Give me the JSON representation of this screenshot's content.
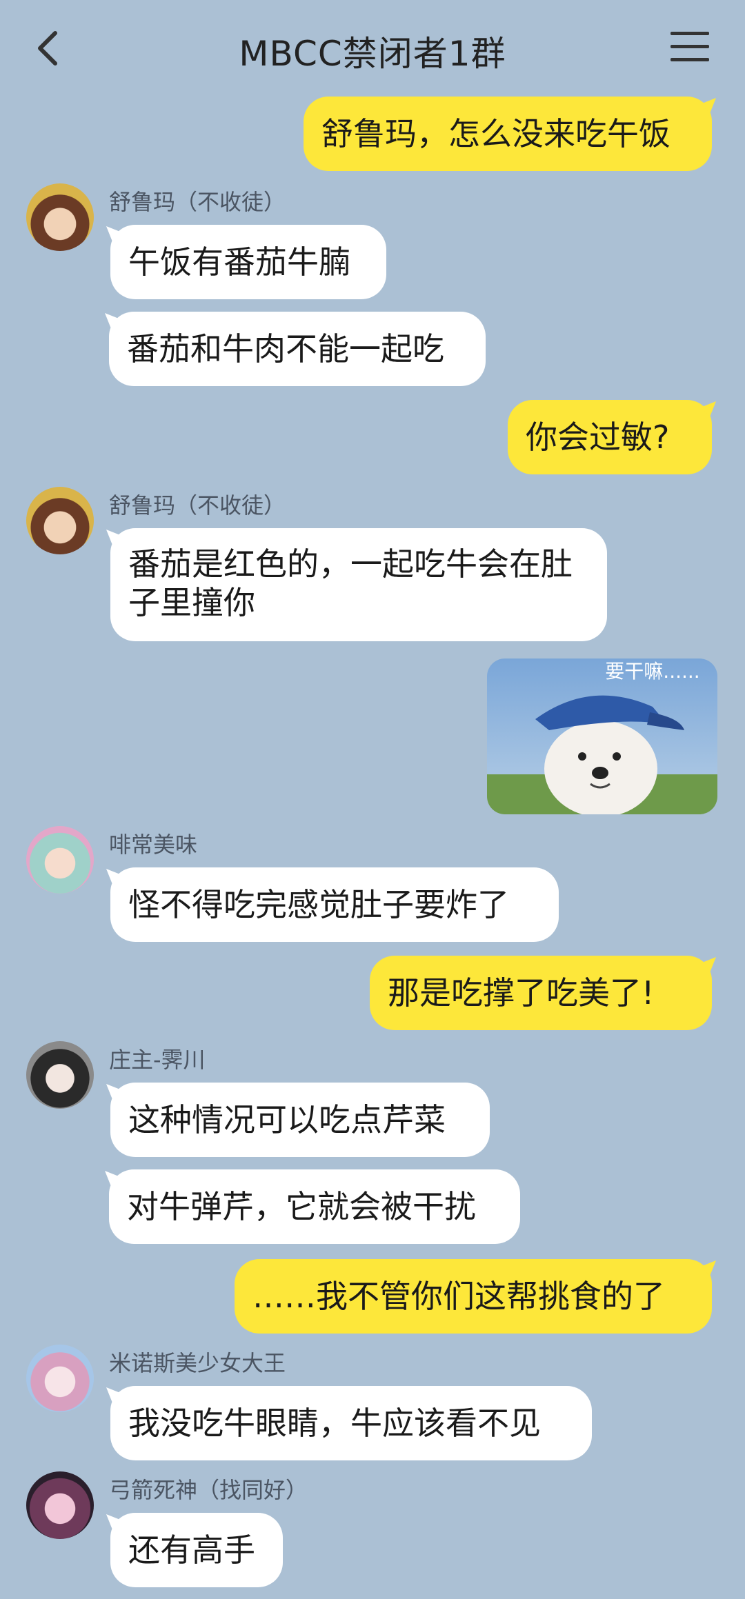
{
  "header": {
    "title": "MBCC禁闭者1群"
  },
  "colors": {
    "background": "#abc0d4",
    "outgoing_bubble": "#fde73a",
    "incoming_bubble": "#ffffff"
  },
  "messages": [
    {
      "text": "舒鲁玛，怎么没来吃午饭"
    },
    {
      "sender": "舒鲁玛（不收徒）",
      "text": "午饭有番茄牛腩"
    },
    {
      "text": "番茄和牛肉不能一起吃"
    },
    {
      "text": "你会过敏?"
    },
    {
      "sender": "舒鲁玛（不收徒）",
      "text": "番茄是红色的，一起吃牛会在肚子里撞你"
    },
    {
      "sticker_caption": "要干嘛......"
    },
    {
      "sender": "啡常美味",
      "text": "怪不得吃完感觉肚子要炸了"
    },
    {
      "text": "那是吃撑了吃美了!"
    },
    {
      "sender": "庄主-霁川",
      "text": "这种情况可以吃点芹菜"
    },
    {
      "text": "对牛弹芹，它就会被干扰"
    },
    {
      "text": "……我不管你们这帮挑食的了"
    },
    {
      "sender": "米诺斯美少女大王",
      "text": "我没吃牛眼睛，牛应该看不见"
    },
    {
      "sender": "弓箭死神（找同好）",
      "text": "还有高手"
    }
  ]
}
